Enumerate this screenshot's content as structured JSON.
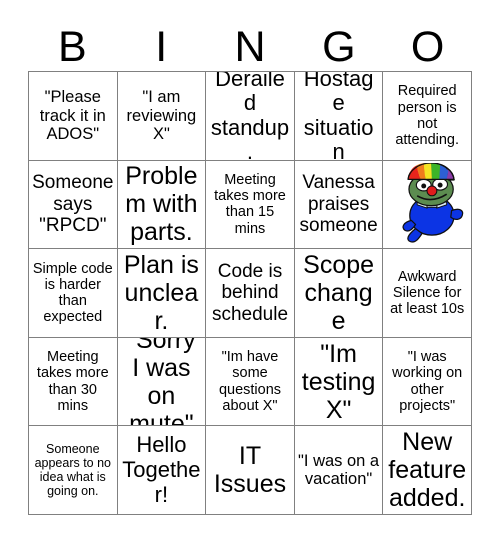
{
  "card": {
    "title_letters": [
      "B",
      "I",
      "N",
      "G",
      "O"
    ],
    "background_color": "#ffffff",
    "grid_line_color": "#808080",
    "text_color": "#000000",
    "rows": 5,
    "columns": 5
  },
  "squares": [
    [
      {
        "text": "\"Please track it in ADOS\"",
        "size": "md",
        "type": "text"
      },
      {
        "text": "\"I am reviewing X\"",
        "size": "md",
        "type": "text"
      },
      {
        "text": "Derailed standup.",
        "size": "xl",
        "type": "text"
      },
      {
        "text": "Hostage situation",
        "size": "xl",
        "type": "text"
      },
      {
        "text": "Required person is not attending.",
        "size": "sm",
        "type": "text"
      }
    ],
    [
      {
        "text": "Someone says \"RPCD\"",
        "size": "lg",
        "type": "text"
      },
      {
        "text": "Problem with parts.",
        "size": "xxl",
        "type": "text"
      },
      {
        "text": "Meeting takes more than 15 mins",
        "size": "sm",
        "type": "text"
      },
      {
        "text": "Vanessa praises someone",
        "size": "lg",
        "type": "text"
      },
      {
        "text": "",
        "size": "md",
        "type": "image",
        "image_name": "clown-pepe-image"
      }
    ],
    [
      {
        "text": "Simple code is harder than expected",
        "size": "sm",
        "type": "text"
      },
      {
        "text": "Plan is unclear.",
        "size": "xxl",
        "type": "text"
      },
      {
        "text": "Code is behind schedule",
        "size": "lg",
        "type": "text"
      },
      {
        "text": "Scope change",
        "size": "xxl",
        "type": "text"
      },
      {
        "text": "Awkward Silence for at least 10s",
        "size": "sm",
        "type": "text"
      }
    ],
    [
      {
        "text": "Meeting takes more than 30 mins",
        "size": "sm",
        "type": "text"
      },
      {
        "text": "\"Sorry I was on mute\"",
        "size": "xxl",
        "type": "text"
      },
      {
        "text": "\"Im have some questions about X\"",
        "size": "sm",
        "type": "text"
      },
      {
        "text": "\"Im testing X\"",
        "size": "xxl",
        "type": "text"
      },
      {
        "text": "\"I was working on other projects\"",
        "size": "sm",
        "type": "text"
      }
    ],
    [
      {
        "text": "Someone appears to no idea what is going on.",
        "size": "xs",
        "type": "text"
      },
      {
        "text": "Hello Together!",
        "size": "xl",
        "type": "text"
      },
      {
        "text": "IT Issues",
        "size": "xxl",
        "type": "text"
      },
      {
        "text": "\"I was on a vacation\"",
        "size": "md",
        "type": "text"
      },
      {
        "text": "New feature added.",
        "size": "xxl",
        "type": "text"
      }
    ]
  ],
  "image_colors": {
    "hat_red": "#e8241c",
    "hat_orange": "#f07c1c",
    "hat_yellow": "#f4e422",
    "hat_green": "#3cb428",
    "hat_blue": "#2d5fd4",
    "hat_purple": "#8c3ca8",
    "face_green": "#5c8c50",
    "nose_red": "#e01c1c",
    "body_blue": "#0c34e4",
    "bowtie_white": "#d8e8f4",
    "eye_white": "#ffffff",
    "outline_black": "#101010"
  }
}
